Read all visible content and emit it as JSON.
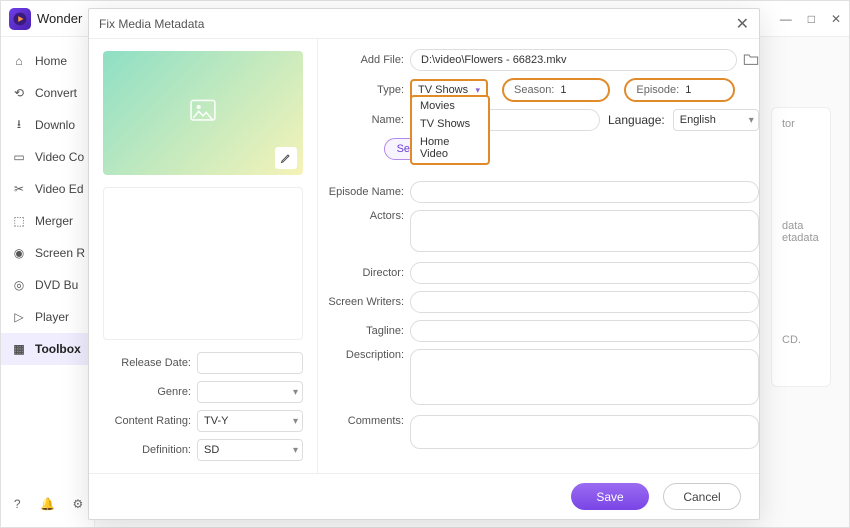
{
  "app": {
    "title": "Wonder"
  },
  "win_controls": {
    "min": "—",
    "max": "□",
    "close": "✕"
  },
  "sidebar": {
    "items": [
      {
        "label": "Home"
      },
      {
        "label": "Convert"
      },
      {
        "label": "Downlo"
      },
      {
        "label": "Video Co"
      },
      {
        "label": "Video Ed"
      },
      {
        "label": "Merger"
      },
      {
        "label": "Screen R"
      },
      {
        "label": "DVD Bu"
      },
      {
        "label": "Player"
      },
      {
        "label": "Toolbox"
      }
    ]
  },
  "rhs": {
    "l1": "tor",
    "l2": "data",
    "l3": "etadata",
    "l4": "CD."
  },
  "modal": {
    "title": "Fix Media Metadata",
    "addfile_label": "Add File:",
    "addfile_value": "D:\\video\\Flowers - 66823.mkv",
    "type_label": "Type:",
    "type_value": "TV Shows",
    "type_options": [
      "Movies",
      "TV Shows",
      "Home Video"
    ],
    "season_label": "Season:",
    "season_value": "1",
    "episode_label": "Episode:",
    "episode_value": "1",
    "name_label": "Name:",
    "language_label": "Language:",
    "language_value": "English",
    "search_label": "Search",
    "episode_name_label": "Episode Name:",
    "actors_label": "Actors:",
    "director_label": "Director:",
    "screenwriters_label": "Screen Writers:",
    "tagline_label": "Tagline:",
    "description_label": "Description:",
    "comments_label": "Comments:",
    "left": {
      "release_date_label": "Release Date:",
      "genre_label": "Genre:",
      "content_rating_label": "Content Rating:",
      "content_rating_value": "TV-Y",
      "definition_label": "Definition:",
      "definition_value": "SD"
    },
    "save_label": "Save",
    "cancel_label": "Cancel"
  }
}
